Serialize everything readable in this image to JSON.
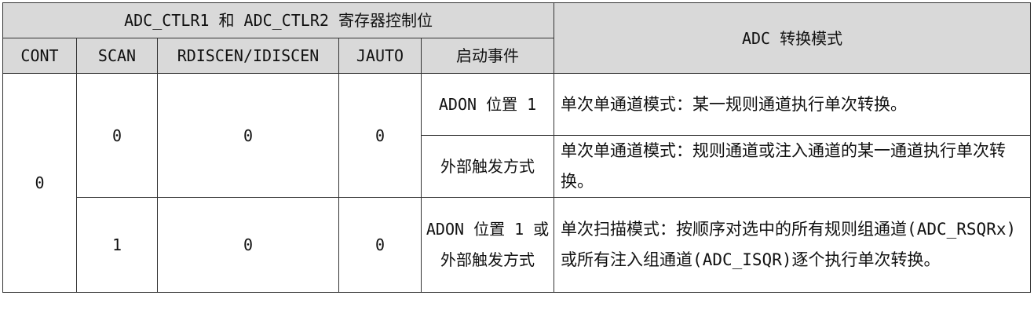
{
  "table": {
    "group_header": "ADC_CTLR1 和 ADC_CTLR2 寄存器控制位",
    "mode_header": "ADC 转换模式",
    "columns": [
      "CONT",
      "SCAN",
      "RDISCEN/IDISCEN",
      "JAUTO",
      "启动事件"
    ],
    "rows": [
      {
        "cont": "0",
        "scan": "0",
        "discen": "0",
        "jauto": "0",
        "start": "ADON 位置 1",
        "mode": "单次单通道模式：某一规则通道执行单次转换。"
      },
      {
        "start": "外部触发方式",
        "mode": "单次单通道模式：规则通道或注入通道的某一通道执行单次转换。"
      },
      {
        "scan": "1",
        "discen": "0",
        "jauto": "0",
        "start": "ADON 位置 1 或外部触发方式",
        "mode": "单次扫描模式：按顺序对选中的所有规则组通道(ADC_RSQRx)或所有注入组通道(ADC_ISQR)逐个执行单次转换。"
      }
    ]
  }
}
